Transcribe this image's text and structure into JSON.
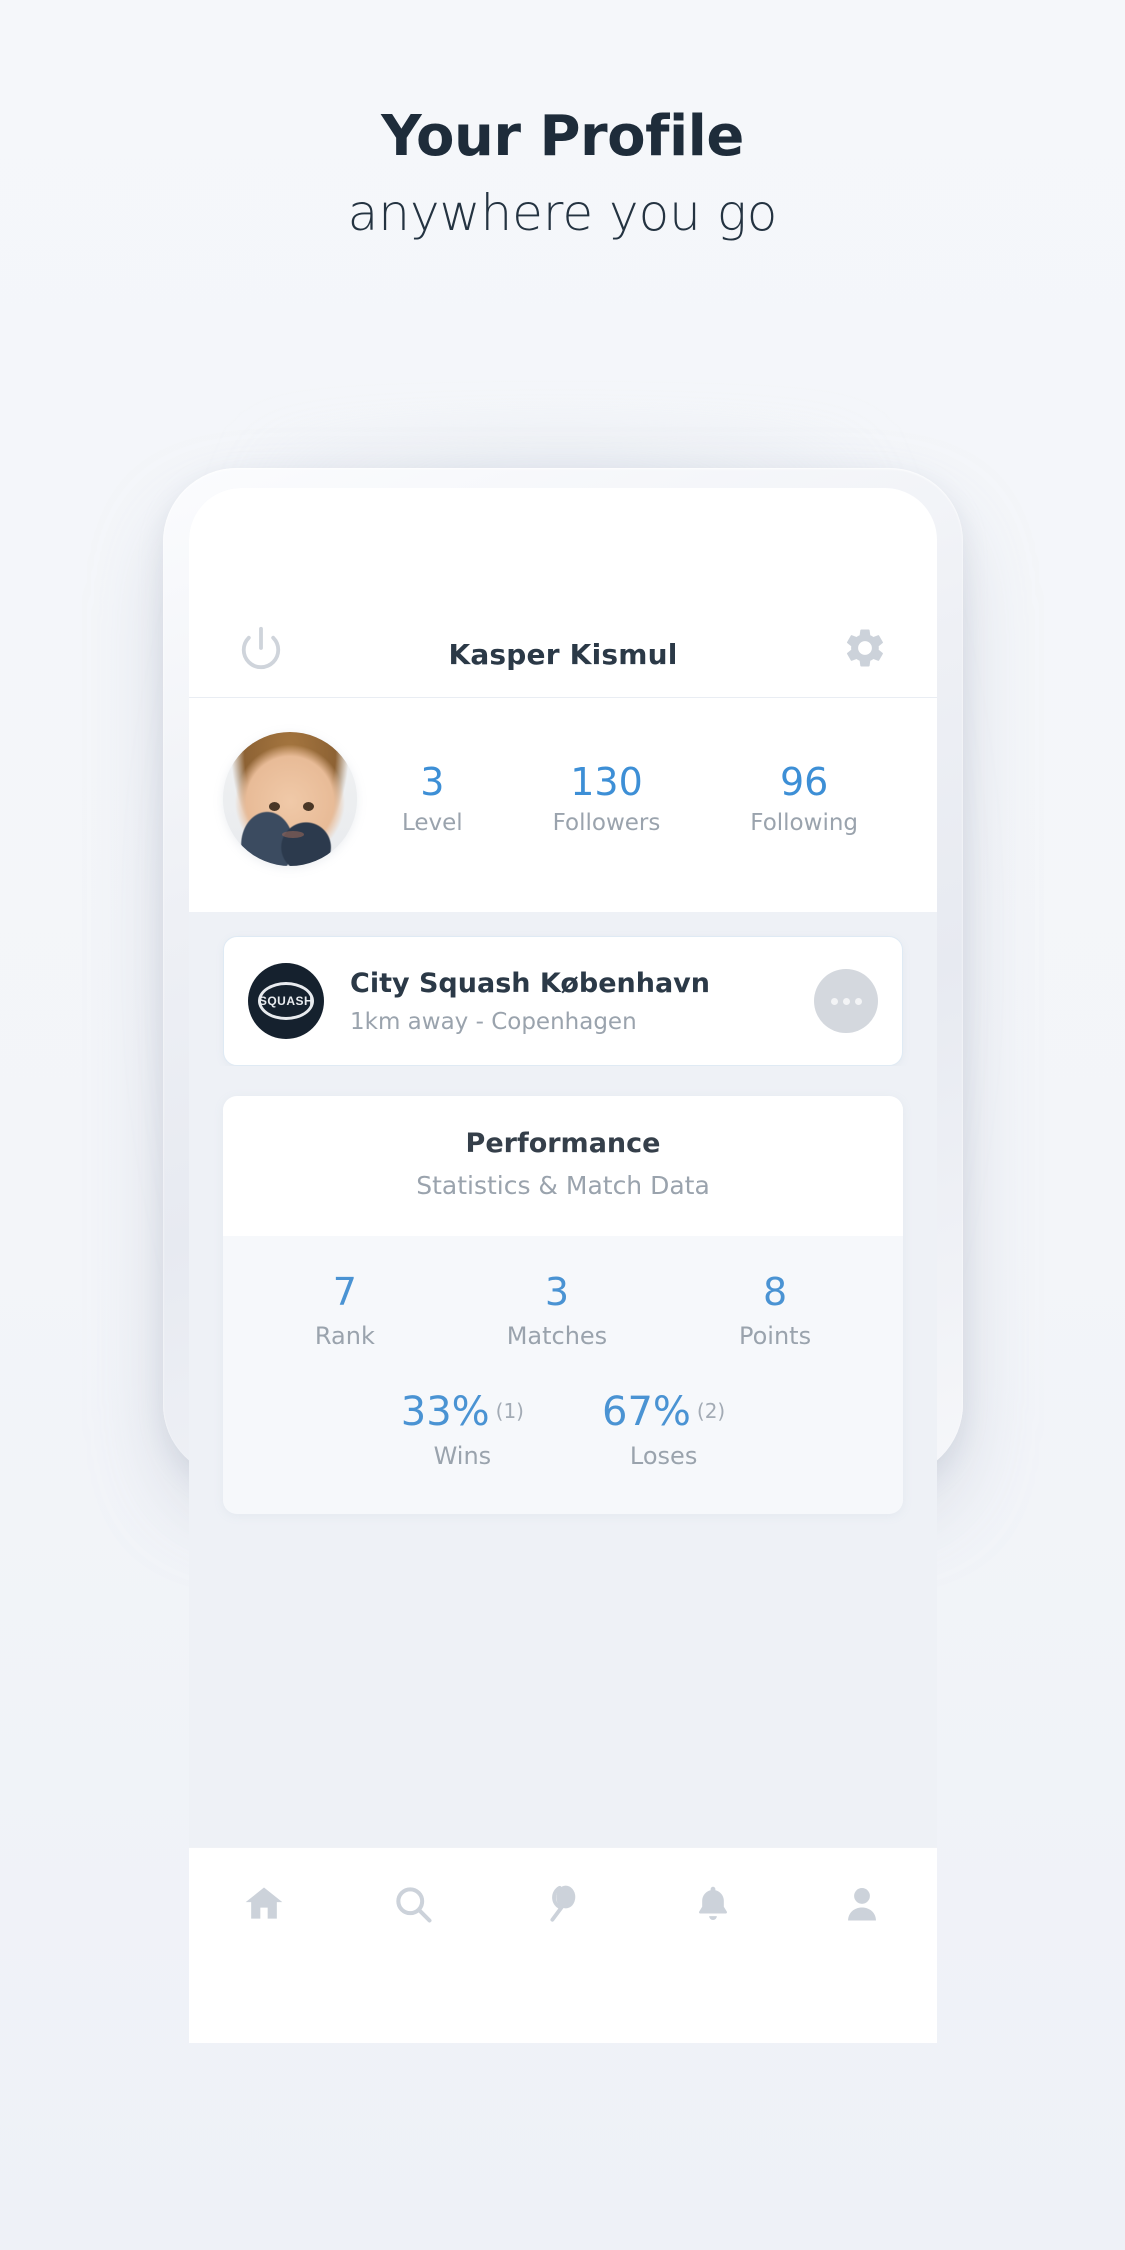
{
  "headline": {
    "title": "Your Profile",
    "subtitle": "anywhere you go"
  },
  "colors": {
    "accent_blue": "#3d8fd6",
    "heading_dark": "#1e2c3a",
    "muted_gray": "#9aa3ad",
    "icon_gray": "#ccd2da",
    "page_bg": "#f4f6fa",
    "card_bg": "#ffffff",
    "screen_bg": "#eef1f6"
  },
  "app_header": {
    "power_icon": "power-icon",
    "title": "Kasper Kismul",
    "settings_icon": "gear-icon"
  },
  "profile": {
    "avatar_alt": "Kasper Kismul profile photo",
    "stats": [
      {
        "value": "3",
        "label": "Level"
      },
      {
        "value": "130",
        "label": "Followers"
      },
      {
        "value": "96",
        "label": "Following"
      }
    ]
  },
  "club_card": {
    "logo_text": "SQUASH",
    "name": "City Squash København",
    "subtitle": "1km away - Copenhagen",
    "more_label": "•••"
  },
  "performance": {
    "title": "Performance",
    "subtitle": "Statistics & Match Data",
    "primary_stats": [
      {
        "value": "7",
        "label": "Rank"
      },
      {
        "value": "3",
        "label": "Matches"
      },
      {
        "value": "8",
        "label": "Points"
      }
    ],
    "ratio_stats": [
      {
        "value": "33%",
        "count": "(1)",
        "label": "Wins"
      },
      {
        "value": "67%",
        "count": "(2)",
        "label": "Loses"
      }
    ]
  },
  "bottom_nav": {
    "items": [
      {
        "icon": "home-icon",
        "label": "Home"
      },
      {
        "icon": "search-icon",
        "label": "Search"
      },
      {
        "icon": "racket-icon",
        "label": "Play"
      },
      {
        "icon": "bell-icon",
        "label": "Notifications"
      },
      {
        "icon": "person-icon",
        "label": "Profile"
      }
    ]
  }
}
